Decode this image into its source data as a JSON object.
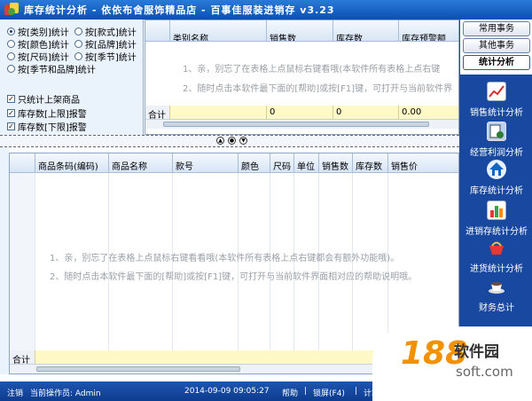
{
  "window": {
    "title": "库存统计分析 - 依依布舍服饰精品店 - 百事佳服装进销存 v3.23"
  },
  "filters": {
    "radios": [
      {
        "label": "按[类别]统计",
        "selected": true
      },
      {
        "label": "按[款式]统计",
        "selected": false
      },
      {
        "label": "按[颜色]统计",
        "selected": false
      },
      {
        "label": "按[品牌]统计",
        "selected": false
      },
      {
        "label": "按[尺码]统计",
        "selected": false
      },
      {
        "label": "按[季节]统计",
        "selected": false
      },
      {
        "label": "按[季节和品牌]统计",
        "selected": false
      }
    ],
    "checkboxes": [
      {
        "label": "只统计上架商品",
        "checked": true
      },
      {
        "label": "库存数[上限]报警",
        "checked": true
      },
      {
        "label": "库存数[下限]报警",
        "checked": true
      }
    ]
  },
  "top_grid": {
    "columns": [
      "类别名称",
      "销售数",
      "库存数",
      "库存预警额"
    ],
    "hint1": "1、亲，别忘了在表格上点鼠标右键看哦(本软件所有表格上点右键",
    "hint2": "2、随时点击本软件最下面的[帮助]或按[F1]键，可打开与当前软件界",
    "total_label": "合计",
    "totals": [
      "",
      "0",
      "0",
      "0.00"
    ]
  },
  "bottom_grid": {
    "columns": [
      "商品条码(编码)",
      "商品名称",
      "款号",
      "颜色",
      "尺码",
      "单位",
      "销售数",
      "库存数",
      "销售价"
    ],
    "hint1": "1、亲，别忘了在表格上点鼠标右键看看哦(本软件所有表格上点右键都会有额外功能哦)。",
    "hint2": "2、随时点击本软件最下面的[帮助]或按[F1]键，可打开与当前软件界面相对应的帮助说明哦。",
    "total_label": "合计"
  },
  "sidebar": {
    "tabs": [
      "常用事务",
      "其他事务",
      "统计分析"
    ],
    "items": [
      {
        "label": "销售统计分析",
        "icon": "line-chart-icon"
      },
      {
        "label": "经营利润分析",
        "icon": "profit-report-icon"
      },
      {
        "label": "库存统计分析",
        "icon": "house-icon"
      },
      {
        "label": "进销存统计分析",
        "icon": "bar-chart-icon"
      },
      {
        "label": "进货统计分析",
        "icon": "basket-icon"
      },
      {
        "label": "财务总计",
        "icon": "coffee-cup-icon"
      }
    ]
  },
  "status": {
    "logout": "注销",
    "operator": "当前操作员: Admin",
    "datetime": "2014-09-09 09:05:27",
    "help": "帮助",
    "lock": "锁屏(F4)",
    "calc": "计算"
  },
  "watermark": {
    "number": "188",
    "cn": "软件园",
    "url": "soft.com"
  },
  "colors": {
    "title_bar": "#0b4fb4",
    "sidebar_panel": "#1848a0",
    "total_row": "#fff9c8"
  }
}
